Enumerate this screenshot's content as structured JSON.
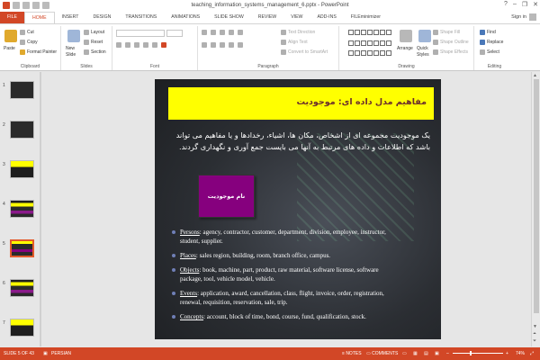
{
  "window": {
    "title": "teaching_information_systems_management_6.pptx - PowerPoint",
    "signin": "Sign in",
    "help": "?",
    "min": "–",
    "restore": "❐",
    "close": "✕"
  },
  "tabs": [
    "FILE",
    "HOME",
    "INSERT",
    "DESIGN",
    "TRANSITIONS",
    "ANIMATIONS",
    "SLIDE SHOW",
    "REVIEW",
    "VIEW",
    "ADD-INS",
    "FILEminimizer"
  ],
  "ribbon": {
    "clipboard": {
      "paste": "Paste",
      "cut": "Cut",
      "copy": "Copy",
      "format_painter": "Format Painter",
      "label": "Clipboard"
    },
    "slides": {
      "new_slide_line1": "New",
      "new_slide_line2": "Slide",
      "layout": "Layout",
      "reset": "Reset",
      "section": "Section",
      "label": "Slides"
    },
    "font": {
      "label": "Font"
    },
    "paragraph": {
      "text_direction": "Text Direction",
      "align_text": "Align Text",
      "convert_smartart": "Convert to SmartArt",
      "label": "Paragraph"
    },
    "drawing": {
      "arrange": "Arrange",
      "quick_styles_line1": "Quick",
      "quick_styles_line2": "Styles",
      "shape_fill": "Shape Fill",
      "shape_outline": "Shape Outline",
      "shape_effects": "Shape Effects",
      "label": "Drawing"
    },
    "editing": {
      "find": "Find",
      "replace": "Replace",
      "select": "Select",
      "label": "Editing"
    }
  },
  "thumbnails": [
    {
      "num": "1",
      "style": "dark"
    },
    {
      "num": "2",
      "style": "dark"
    },
    {
      "num": "3",
      "style": "yellow"
    },
    {
      "num": "4",
      "style": "purple"
    },
    {
      "num": "5",
      "style": "selected"
    },
    {
      "num": "6",
      "style": "purple"
    },
    {
      "num": "7",
      "style": "yellow"
    }
  ],
  "slide": {
    "header": "مفاهیم مدل داده ای: موجودیت",
    "paragraph": "یک موجودیت مجموعه ای از اشخاص، مکان ها، اشیاء، رخدادها و یا مفاهیم می تواند باشد که اطلاعات و داده های مرتبط به آنها می بایست جمع آوری و نگهداری گردند.",
    "entity_box": "نام موجودیت",
    "bullets": [
      {
        "key": "Persons",
        "text": ":  agency, contractor, customer, department, division, employee, instructor, student, supplier."
      },
      {
        "key": "Places",
        "text": ":  sales region, building, room, branch office, campus."
      },
      {
        "key": "Objects",
        "text": ":  book, machine, part, product, raw material, software license, software package, tool, vehicle model, vehicle."
      },
      {
        "key": "Events",
        "text": ":  application, award, cancellation, class, flight, invoice, order, registration, renewal, requisition, reservation, sale, trip."
      },
      {
        "key": "Concepts",
        "text": ":  account, block of time, bond, course, fund, qualification, stock."
      }
    ]
  },
  "status": {
    "slide_of": "SLIDE 5 OF 43",
    "language": "PERSIAN",
    "notes": "NOTES",
    "comments": "COMMENTS",
    "zoom": "74%"
  },
  "colors": {
    "accent": "#d24726",
    "slide_header_bg": "#ffff00",
    "entity_box": "#86007e"
  }
}
